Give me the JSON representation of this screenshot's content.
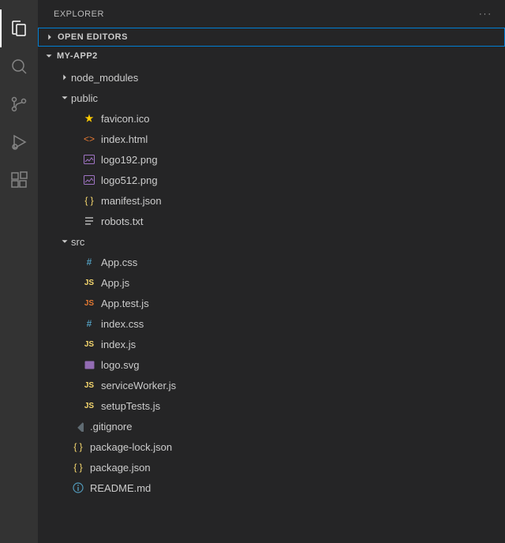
{
  "panel": {
    "title": "Explorer",
    "more": "···"
  },
  "sections": {
    "open_editors": "Open Editors",
    "project": "my-app2"
  },
  "tree": {
    "node_modules": "node_modules",
    "public": "public",
    "public_items": {
      "favicon": "favicon.ico",
      "index_html": "index.html",
      "logo192": "logo192.png",
      "logo512": "logo512.png",
      "manifest": "manifest.json",
      "robots": "robots.txt"
    },
    "src": "src",
    "src_items": {
      "app_css": "App.css",
      "app_js": "App.js",
      "app_test": "App.test.js",
      "index_css": "index.css",
      "index_js": "index.js",
      "logo_svg": "logo.svg",
      "service_worker": "serviceWorker.js",
      "setup_tests": "setupTests.js"
    },
    "gitignore": ".gitignore",
    "pkg_lock": "package-lock.json",
    "pkg": "package.json",
    "readme": "README.md"
  }
}
